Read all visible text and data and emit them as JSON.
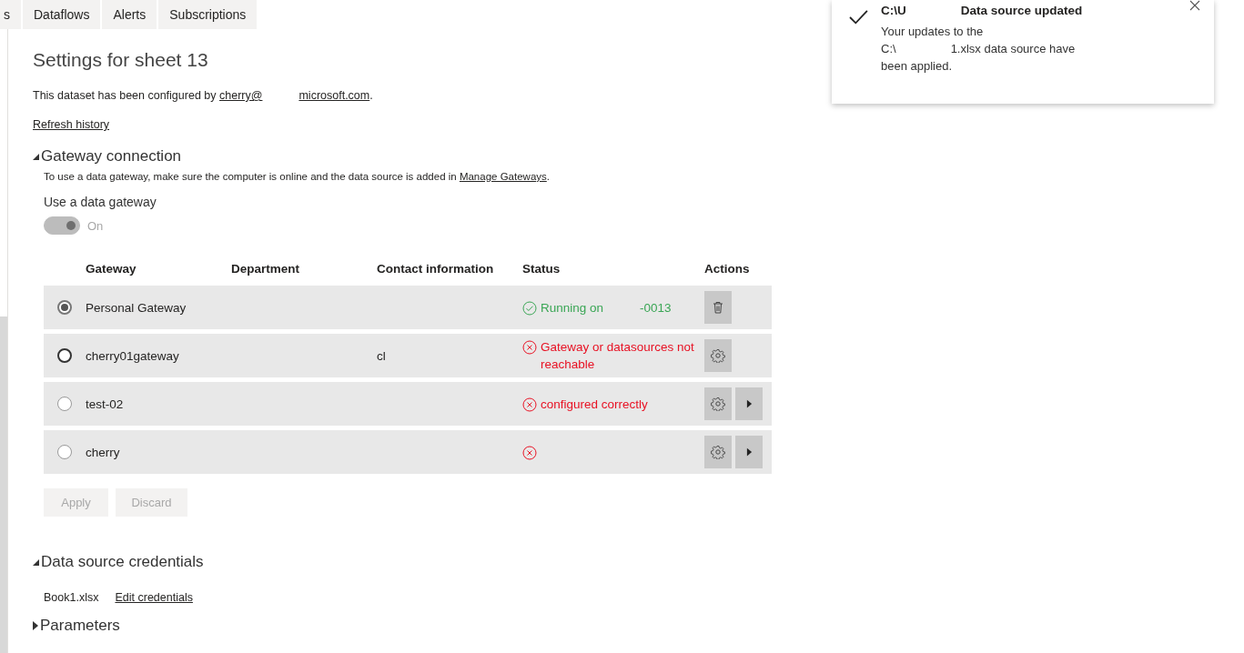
{
  "tabs": [
    {
      "label": "s"
    },
    {
      "label": "Dataflows"
    },
    {
      "label": "Alerts"
    },
    {
      "label": "Subscriptions"
    }
  ],
  "title": "Settings for sheet 13",
  "configured_by": {
    "text": "This dataset has been configured by",
    "link_parts": [
      "cherry@",
      "microsoft.com"
    ],
    "end": "."
  },
  "refresh_history": "Refresh history",
  "gateway_section": {
    "heading": "Gateway connection",
    "expanded": true,
    "hint": "To use a data gateway, make sure the computer is online and the data source is added in",
    "hint_link": "Manage Gateways",
    "hint_end": ".",
    "toggle_label": "Use a data gateway",
    "toggle": {
      "on": true,
      "disabled": true,
      "text": "On"
    }
  },
  "table": {
    "columns": [
      "Gateway",
      "Department",
      "Contact information",
      "Status",
      "Actions"
    ],
    "rows": [
      {
        "gateway": "Personal Gateway",
        "selected": true,
        "disabled": false,
        "contact_parts": [],
        "status": {
          "kind": "ok",
          "parts": [
            "Running on",
            "-0013"
          ]
        },
        "actions": [
          {
            "kind": "delete"
          }
        ]
      },
      {
        "gateway": "cherry01gateway",
        "selected": false,
        "disabled": false,
        "contact_parts": [
          "cl"
        ],
        "status": {
          "kind": "error",
          "parts": [
            "Gateway or datasources not reachable"
          ]
        },
        "actions": [
          {
            "kind": "settings"
          }
        ]
      },
      {
        "gateway": "test-02",
        "selected": false,
        "disabled": true,
        "contact_parts": [],
        "status": {
          "kind": "error",
          "parts": [
            "configured correctly"
          ]
        },
        "actions": [
          {
            "kind": "settings"
          },
          {
            "kind": "expand"
          }
        ]
      },
      {
        "gateway": "cherry",
        "selected": false,
        "disabled": true,
        "contact_parts": [],
        "status": {
          "kind": "error"
        },
        "actions": [
          {
            "kind": "settings"
          },
          {
            "kind": "expand"
          }
        ]
      }
    ]
  },
  "buttons": [
    {
      "label": "Apply",
      "disabled": true
    },
    {
      "label": "Discard",
      "disabled": true
    }
  ],
  "credentials_section": {
    "heading": "Data source credentials",
    "expanded": true,
    "file": "Book1.xlsx",
    "link": "Edit credentials"
  },
  "parameters_section": {
    "heading": "Parameters",
    "expanded": false
  },
  "toast": {
    "title_parts": [
      "C:\\U",
      "Data source updated"
    ],
    "message_lines": [
      [
        "Your updates to the"
      ],
      [
        "C:\\",
        "1.xlsx data source have"
      ],
      [
        "been applied."
      ]
    ]
  }
}
